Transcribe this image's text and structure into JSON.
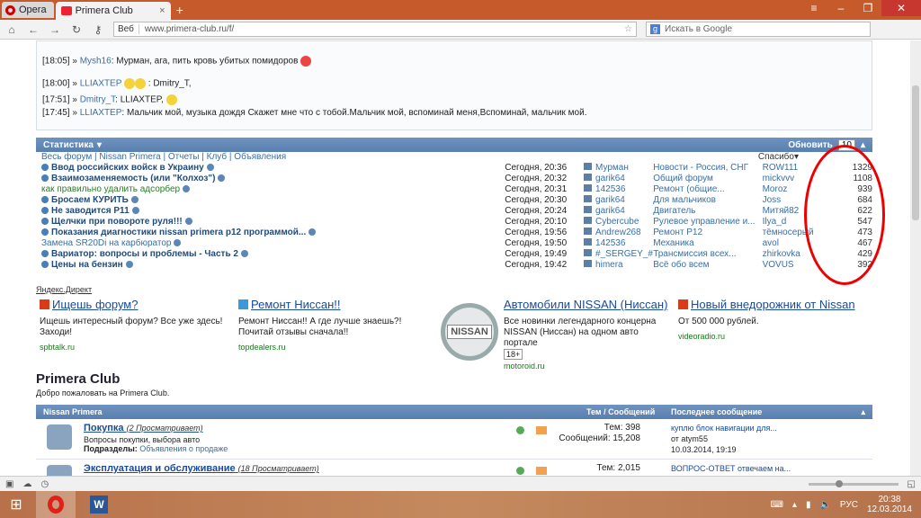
{
  "browser": {
    "menu_label": "Opera",
    "tab_title": "Primera Club",
    "url_badge": "Веб",
    "url": "www.primera-club.ru/f/",
    "search_placeholder": "Искать в Google"
  },
  "chat": [
    {
      "time": "[18:05] »",
      "user": "Mysh16",
      "text": ": Мурман, ага, пить кровь убитых помидоров"
    },
    {
      "time": "[18:00] »",
      "user": "LLIAXTEP",
      "text": ":       Dmitry_T,"
    },
    {
      "time": "[17:51] »",
      "user": "Dmitry_T",
      "text": ": LLIAXTEP,"
    },
    {
      "time": "[17:45] »",
      "user": "LLIAXTEP",
      "text": ": Мальчик мой, музыка дождя Скажет мне что с тобой.Мальчик мой, вспоминай меня,Вспоминай, мальчик мой."
    }
  ],
  "stats": {
    "title": "Статистика",
    "refresh_label": "Обновить",
    "refresh_value": "10",
    "subnav": [
      "Весь форум",
      "Nissan Primera",
      "Отчеты",
      "Клуб",
      "Объявления"
    ],
    "thanks_header": "Спасибо",
    "rows": [
      {
        "topic": "Ввод российских войск в Украину",
        "style": "bold",
        "date": "Сегодня, 20:36",
        "user": "Мурман",
        "forum": "Новости - Россия, СНГ",
        "starter": "ROW111",
        "count": "1329"
      },
      {
        "topic": "Взаимозаменяемость (или \"Колхоз\")",
        "style": "bold",
        "date": "Сегодня, 20:32",
        "user": "garik64",
        "forum": "Общий форум",
        "starter": "mickvvv",
        "count": "1108"
      },
      {
        "topic": "как правильно удалить адсорбер",
        "style": "green",
        "date": "Сегодня, 20:31",
        "user": "142536",
        "forum": "Ремонт (общие...",
        "starter": "Moroz",
        "count": "939"
      },
      {
        "topic": "Бросаем КУРИТЬ",
        "style": "bold",
        "date": "Сегодня, 20:30",
        "user": "garik64",
        "forum": "Для мальчиков",
        "starter": "Joss",
        "count": "684"
      },
      {
        "topic": "Не заводится Р11",
        "style": "bold",
        "date": "Сегодня, 20:24",
        "user": "garik64",
        "forum": "Двигатель",
        "starter": "Митяй82",
        "count": "622"
      },
      {
        "topic": "Щелчки при повороте руля!!!",
        "style": "bold",
        "date": "Сегодня, 20:10",
        "user": "Cybercube",
        "forum": "Рулевое управление и...",
        "starter": "Ilya_d",
        "count": "547"
      },
      {
        "topic": "Показания диагностики nissan primera p12 программой...",
        "style": "bold",
        "date": "Сегодня, 19:56",
        "user": "Andrew268",
        "forum": "Ремонт Р12",
        "starter": "тёмносерый",
        "count": "473"
      },
      {
        "topic": "Замена SR20Di на карбюратор",
        "style": "plain",
        "date": "Сегодня, 19:50",
        "user": "142536",
        "forum": "Механика",
        "starter": "avol",
        "count": "467"
      },
      {
        "topic": "Вариатор: вопросы и проблемы - Часть 2",
        "style": "bold",
        "date": "Сегодня, 19:49",
        "user": "#_SERGEY_#",
        "forum": "Трансмиссия всех...",
        "starter": "zhirkovka",
        "count": "429"
      },
      {
        "topic": "Цены на бензин",
        "style": "bold",
        "date": "Сегодня, 19:42",
        "user": "himera",
        "forum": "Всё обо всем",
        "starter": "VOVUS",
        "count": "392"
      }
    ]
  },
  "ads": {
    "label": "Яндекс.Директ",
    "items": [
      {
        "title": "Ищешь форум?",
        "desc": "Ищешь интересный форум? Все уже здесь! Заходи!",
        "domain": "spbtalk.ru",
        "icon_color": "#d83a1a"
      },
      {
        "title": "Ремонт Ниссан!!",
        "desc": "Ремонт Ниссан!! А где лучше знаешь?! Почитай отзывы сначала!!",
        "domain": "topdealers.ru",
        "icon_color": "#3a9ad8"
      },
      {
        "title": "Автомобили NISSAN (Ниссан)",
        "desc": "Все новинки легендарного концерна NISSAN (Ниссан) на одном авто портале",
        "domain": "motoroid.ru",
        "age": "18+",
        "logo_text": "NISSAN"
      },
      {
        "title": "Новый внедорожник от Nissan",
        "desc": "От 500 000 рублей.",
        "domain": "videoradio.ru",
        "icon_color": "#d83a1a"
      }
    ]
  },
  "club": {
    "title": "Primera Club",
    "welcome": "Добро пожаловать на Primera Club.",
    "section": "Nissan Primera",
    "col_counts": "Тем / Сообщений",
    "col_last": "Последнее сообщение",
    "forums": [
      {
        "title": "Покупка",
        "viewers": "(2 Просматривает)",
        "desc": "Вопросы покупки, выбора авто",
        "sub_label": "Подразделы:",
        "sub_link": "Объявления о продаже",
        "topics": "Тем: 398",
        "posts": "Сообщений: 15,208",
        "last_title": "куплю блок навигации для...",
        "last_by": "от atym55",
        "last_date": "10.03.2014, 19:19"
      },
      {
        "title": "Эксплуатация и обслуживание",
        "viewers": "(18 Просматривает)",
        "topics": "Тем: 2,015",
        "last_title": "ВОПРОС-ОТВЕТ отвечаем на..."
      }
    ]
  },
  "taskbar": {
    "lang": "РУС",
    "time": "20:38",
    "date": "12.03.2014"
  }
}
